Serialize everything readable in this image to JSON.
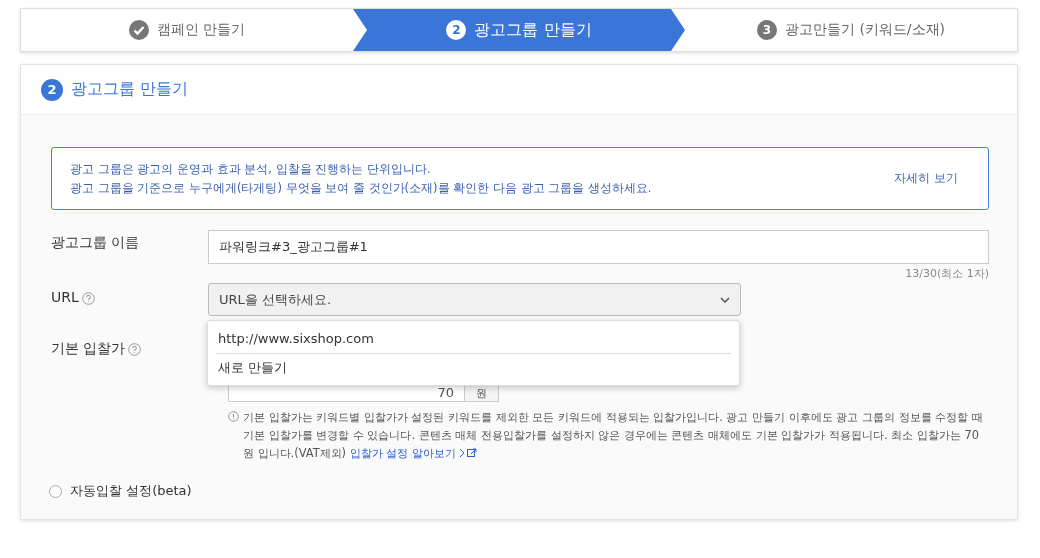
{
  "steps": [
    {
      "label": "캠페인 만들기",
      "kind": "done",
      "selected": false
    },
    {
      "label": "광고그룹 만들기",
      "number": "2",
      "kind": "numbered",
      "selected": true
    },
    {
      "label": "광고만들기 (키워드/소재)",
      "number": "3",
      "kind": "numbered",
      "selected": false
    }
  ],
  "section": {
    "number": "2",
    "title": "광고그룹 만들기"
  },
  "notice": {
    "lines": [
      "광고 그룹은 광고의 운영과 효과 분석, 입찰을 진행하는 단위입니다.",
      "광고 그룹을 기준으로 누구에게(타게팅) 무엇을 보여 줄 것인가(소재)를 확인한 다음 광고 그룹을 생성하세요."
    ],
    "link": "자세히 보기"
  },
  "name_field": {
    "label": "광고그룹 이름",
    "value": "파워링크#3_광고그룹#1",
    "counter": "13/30(최소 1자)"
  },
  "url_field": {
    "label": "URL",
    "placeholder": "URL을 선택하세요.",
    "expanded": true,
    "options": [
      {
        "label": "http://www.sixshop.com"
      },
      {
        "label": "새로 만들기"
      }
    ]
  },
  "bid": {
    "label": "기본 입찰가",
    "value": "70",
    "unit": "원",
    "help": "기본 입찰가는 키워드별 입찰가가 설정된 키워드를 제외한 모든 키워드에 적용되는 입찰가입니다. 광고 만들기 이후에도 광고 그룹의 정보를 수정할 때 기본 입찰가를 변경할 수 있습니다. 콘텐츠 매체 전용입찰가를 설정하지 않은 경우에는 콘텐츠 매체에도 기본 입찰가가 적용됩니다. 최소 입찰가는 70원 입니다.(VAT제외)",
    "help_link": "입찰가 설정 알아보기"
  },
  "auto_bid": {
    "label": "자동입찰 설정(beta)",
    "selected": false
  }
}
